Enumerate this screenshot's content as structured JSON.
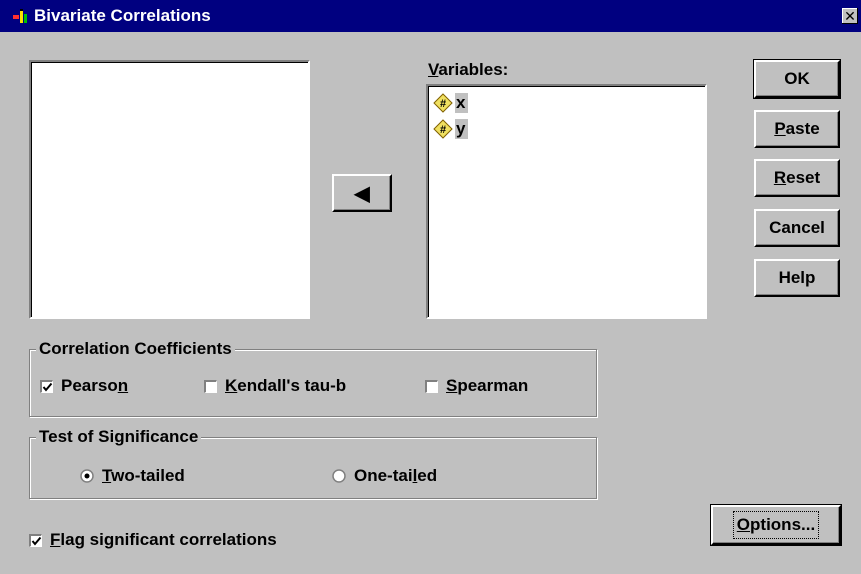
{
  "window": {
    "title": "Bivariate Correlations",
    "close_glyph": "✕"
  },
  "source_list": {
    "items": []
  },
  "move_button": {
    "glyph": "◀"
  },
  "variables": {
    "label_underlined": "V",
    "label_rest": "ariables:",
    "items": [
      {
        "name": "x",
        "icon": "numeric-scale-icon"
      },
      {
        "name": "y",
        "icon": "numeric-scale-icon"
      }
    ]
  },
  "buttons": {
    "ok": "OK",
    "paste_u": "P",
    "paste_rest": "aste",
    "reset_u": "R",
    "reset_rest": "eset",
    "cancel": "Cancel",
    "help": "Help",
    "options_u": "O",
    "options_rest": "ptions..."
  },
  "coefficients": {
    "title": "Correlation Coefficients",
    "pearson": {
      "pre": "Pearso",
      "u": "n",
      "post": "",
      "checked": true
    },
    "kendall": {
      "pre": "",
      "u": "K",
      "post": "endall's tau-b",
      "checked": false
    },
    "spearman": {
      "pre": "",
      "u": "S",
      "post": "pearman",
      "checked": false
    }
  },
  "significance": {
    "title": "Test of Significance",
    "two_tailed": {
      "pre": "",
      "u": "T",
      "post": "wo-tailed",
      "selected": true
    },
    "one_tailed": {
      "pre": "One-tai",
      "u": "l",
      "post": "ed",
      "selected": false
    }
  },
  "flag": {
    "pre": "",
    "u": "F",
    "post": "lag significant correlations",
    "checked": true
  },
  "colors": {
    "titlebar": "#000080",
    "face": "#c0c0c0",
    "highlight": "#ffffff",
    "shadow": "#808080"
  }
}
